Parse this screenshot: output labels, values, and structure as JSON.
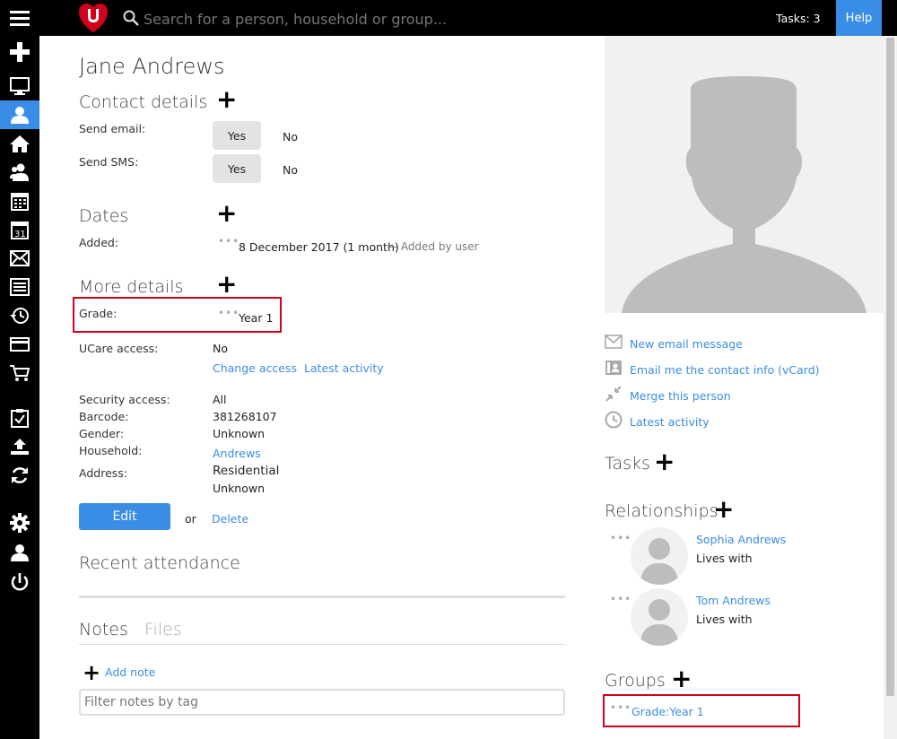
{
  "search": {
    "placeholder": "Search for a person, household or group..."
  },
  "topbar": {
    "tasks": "Tasks: 3",
    "help": "Help"
  },
  "person": {
    "name": "Jane Andrews"
  },
  "contact": {
    "title": "Contact details",
    "send_email_label": "Send email:",
    "send_sms_label": "Send SMS:",
    "yes": "Yes",
    "no": "No"
  },
  "dates": {
    "title": "Dates",
    "added_label": "Added:",
    "added_value": "8 December 2017 (1 month)",
    "added_by": "— Added by user"
  },
  "more": {
    "title": "More details",
    "grade_label": "Grade:",
    "grade_value": "Year 1"
  },
  "access": {
    "ucare_label": "UCare access:",
    "ucare_value": "No",
    "change_access": "Change access",
    "latest_activity": "Latest activity"
  },
  "info": {
    "security_label": "Security access:",
    "security_value": "All",
    "barcode_label": "Barcode:",
    "barcode_value": "381268107",
    "gender_label": "Gender:",
    "gender_value": "Unknown",
    "household_label": "Household:",
    "household_value": "Andrews",
    "address_label": "Address:",
    "address_line1": "Residential",
    "address_line2": "Unknown"
  },
  "actions": {
    "edit": "Edit",
    "or": "or",
    "delete": "Delete"
  },
  "attendance": {
    "title": "Recent attendance"
  },
  "notes": {
    "tab_notes": "Notes",
    "tab_files": "Files",
    "add_note": "Add note",
    "filter_placeholder": "Filter notes by tag"
  },
  "side_links": {
    "email": "New email message",
    "vcard": "Email me the contact info (vCard)",
    "merge": "Merge this person",
    "activity": "Latest activity"
  },
  "tasks": {
    "title": "Tasks"
  },
  "relationships": {
    "title": "Relationships",
    "items": [
      {
        "name": "Sophia Andrews",
        "relation": "Lives with"
      },
      {
        "name": "Tom Andrews",
        "relation": "Lives with"
      }
    ]
  },
  "groups": {
    "title": "Groups",
    "items": [
      {
        "name": "Grade:Year 1"
      }
    ]
  },
  "colors": {
    "accent": "#3a8de6",
    "highlight": "#d0021b",
    "brand": "#d0021b"
  }
}
